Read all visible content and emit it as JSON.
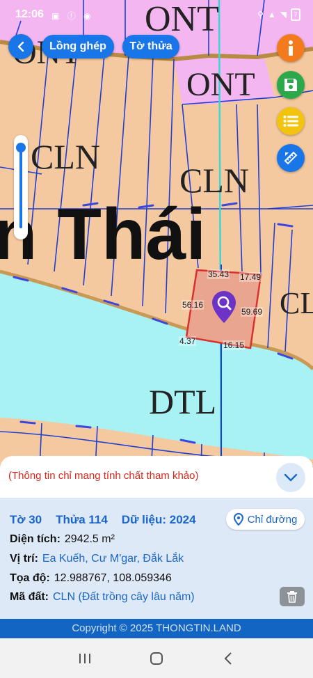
{
  "status_bar": {
    "time": "12:06",
    "left_icons": [
      "screen-icon",
      "facebook-icon",
      "messenger-icon"
    ],
    "right_icons": [
      "location-icon",
      "signal-4g-icon",
      "wifi-icon",
      "battery-icon"
    ],
    "battery_level": "7"
  },
  "toolbar": {
    "back_icon": "chevron-left-icon",
    "long_ghep_label": "Lồng ghép",
    "to_thua_label": "Tờ thửa",
    "side_buttons": [
      "info-icon",
      "save-icon",
      "list-icon",
      "ruler-pencil-icon"
    ]
  },
  "map": {
    "labels": {
      "ont_top": "ONT",
      "ont_top_left": "ONT",
      "ont_right": "ONT",
      "cln_left": "CLN",
      "cln_center": "CLN",
      "cln_right": "CL",
      "place_name": "n Thái",
      "dtl": "DTL"
    },
    "dimensions": {
      "top": "35.43",
      "top_right": "17.49",
      "left": "56.16",
      "right": "59.69",
      "bottom_left": "4.37",
      "bottom": "16.15"
    },
    "colors": {
      "land": "#f5c9a0",
      "residential": "#f3b6f0",
      "water": "#a8f2f4",
      "parcel_highlight": "#e9a58d",
      "boundary": "#1f3fd1",
      "marker": "#6d33c7"
    }
  },
  "zoom_slider": {
    "level": 0.0
  },
  "sheet": {
    "disclaimer": "(Thông tin chỉ mang tính chất tham khảo)",
    "header": {
      "sheet": "Tờ 30",
      "parcel": "Thửa 114",
      "data": "Dữ liệu: 2024"
    },
    "directions_label": "Chỉ đường",
    "area_label": "Diện tích:",
    "area_value": "2942.5 m²",
    "location_label": "Vị trí:",
    "location_value": "Ea Kuếh, Cư M'gar, Đắk Lắk",
    "coords_label": "Tọa độ:",
    "coords_value": "12.988767, 108.059346",
    "land_code_label": "Mã đất:",
    "land_code_value": "CLN (Đất trồng cây lâu năm)"
  },
  "copyright": "Copyright © 2025 THONGTIN.LAND",
  "nav_bar": [
    "recent-apps-icon",
    "home-icon",
    "back-icon"
  ]
}
